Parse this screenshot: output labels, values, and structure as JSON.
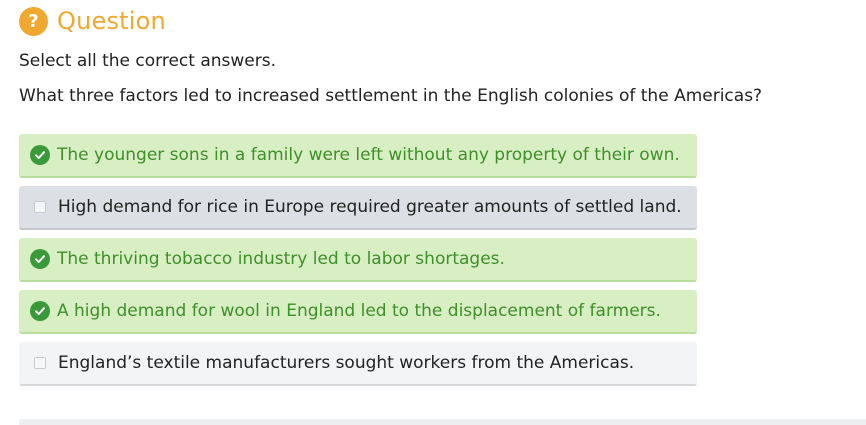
{
  "header": {
    "icon_glyph": "?",
    "title": "Question",
    "accent_color": "#f0a830"
  },
  "instruction": "Select all the correct answers.",
  "prompt": "What three factors led to increased settlement in the English colonies of the Americas?",
  "options": [
    {
      "label": "The younger sons in a family were left without any property of their own.",
      "state": "correct",
      "icon": "check-circle-icon"
    },
    {
      "label": "High demand for rice in Europe required greater amounts of settled land.",
      "state": "unchecked",
      "icon": "checkbox-icon"
    },
    {
      "label": "The thriving tobacco industry led to labor shortages.",
      "state": "correct",
      "icon": "check-circle-icon"
    },
    {
      "label": "A high demand for wool in England led to the displacement of farmers.",
      "state": "correct",
      "icon": "check-circle-icon"
    },
    {
      "label": "England’s textile manufacturers sought workers from the Americas.",
      "state": "unchecked",
      "icon": "checkbox-icon"
    }
  ],
  "colors": {
    "correct_bg": "#d8efc4",
    "correct_text": "#3f8f2a",
    "check_green": "#3a9a3a",
    "neutral_bg": "#dcdfe3"
  }
}
